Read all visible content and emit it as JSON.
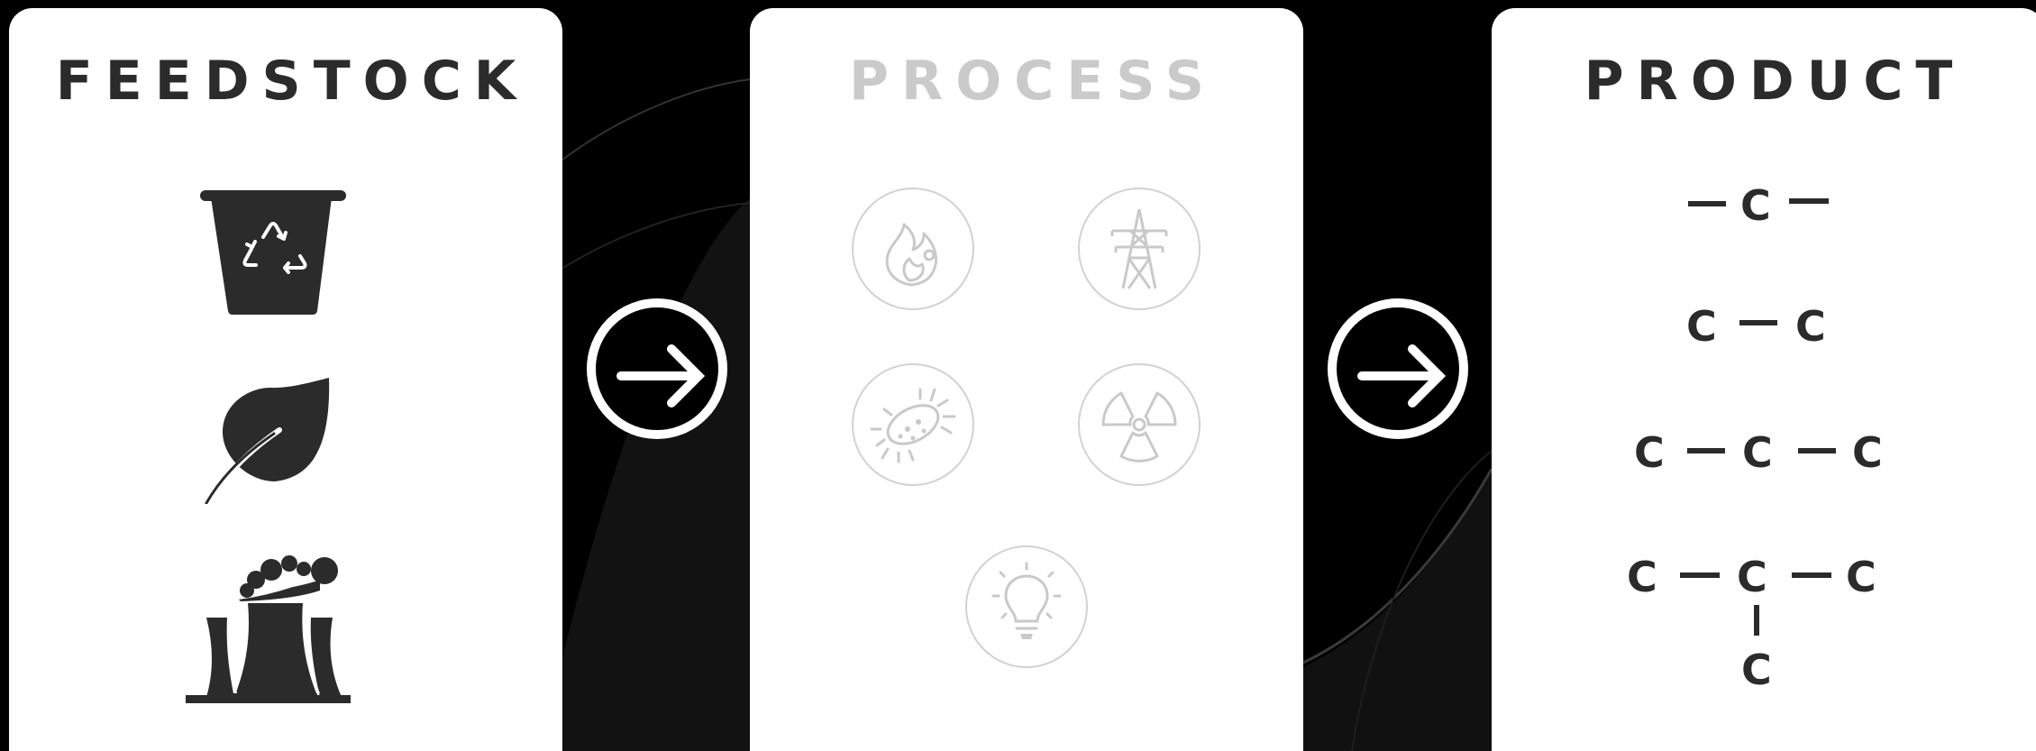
{
  "panels": {
    "feedstock": {
      "title": "FEEDSTOCK"
    },
    "process": {
      "title": "PROCESS"
    },
    "product": {
      "title": "PRODUCT"
    }
  },
  "feedstock_icons": [
    "recycle-bin-icon",
    "leaf-icon",
    "factory-icon"
  ],
  "process_icons": [
    "flame-icon",
    "power-tower-icon",
    "bacteria-icon",
    "radiation-icon",
    "lightbulb-icon"
  ],
  "product_molecules": [
    {
      "atoms": [
        "C"
      ],
      "label": "C1"
    },
    {
      "atoms": [
        "C",
        "C"
      ],
      "label": "C2"
    },
    {
      "atoms": [
        "C",
        "C",
        "C"
      ],
      "label": "C3"
    },
    {
      "atoms": [
        "C",
        "C",
        "C",
        "C"
      ],
      "label": "C4-branched"
    }
  ],
  "atom_symbol": "C",
  "colors": {
    "background": "#000000",
    "panel": "#ffffff",
    "dark_text": "#2b2b2b",
    "muted": "#cacaca"
  }
}
